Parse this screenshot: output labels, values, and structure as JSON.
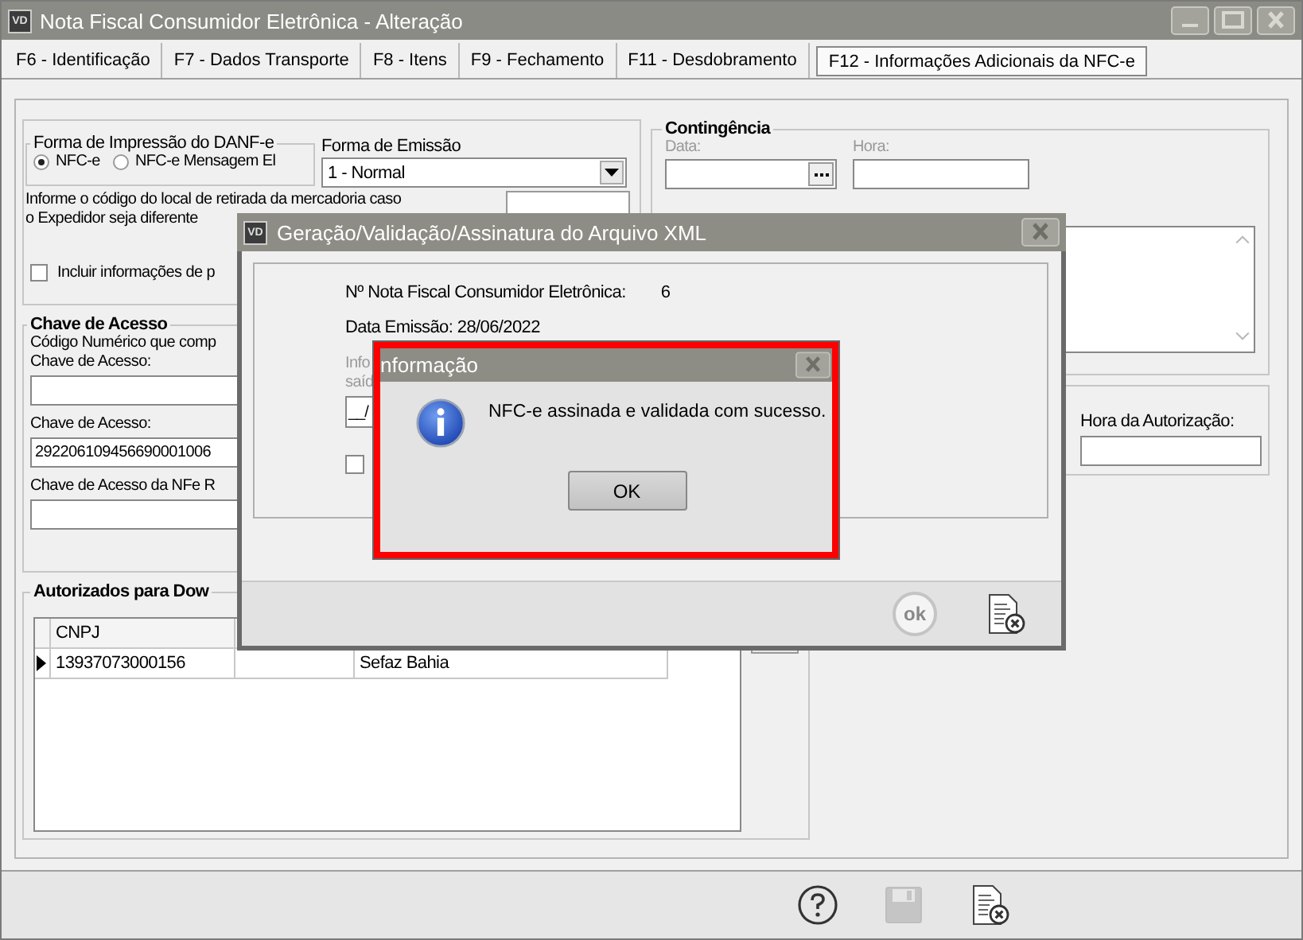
{
  "window": {
    "icon": "VD",
    "title": "Nota Fiscal Consumidor Eletrônica - Alteração"
  },
  "tabs": [
    {
      "label": "F6 - Identificação",
      "selected": false
    },
    {
      "label": "F7 - Dados Transporte",
      "selected": false
    },
    {
      "label": "F8 - Itens",
      "selected": false
    },
    {
      "label": "F9 - Fechamento",
      "selected": false
    },
    {
      "label": "F11 - Desdobramento",
      "selected": false
    },
    {
      "label": "F12 - Informações Adicionais da NFC-e",
      "selected": true
    }
  ],
  "danfe": {
    "title": "Forma de Impressão do DANF-e",
    "options": [
      {
        "label": "NFC-e",
        "selected": true
      },
      {
        "label": "NFC-e Mensagem El",
        "selected": false
      }
    ]
  },
  "emissao": {
    "label": "Forma de Emissão",
    "value": "1 - Normal"
  },
  "retirada": {
    "lines": [
      "Informe o código do local de retirada da mercadoria caso",
      "o Expedidor seja diferente"
    ]
  },
  "incluir": {
    "label": "Incluir informações de p",
    "checked": false
  },
  "chave": {
    "title": "Chave de Acesso",
    "fields": [
      {
        "label_lines": [
          "Código Numérico que comp",
          "Chave de Acesso:"
        ]
      },
      {
        "label_lines": [
          "Chave de Acesso:"
        ],
        "value": "292206109456690001006"
      },
      {
        "label_lines": [
          "Chave de Acesso da NFe R"
        ]
      }
    ]
  },
  "autorizados": {
    "title": "Autorizados para Dow",
    "columns": [
      "CNPJ"
    ],
    "rows": [
      {
        "selected": true,
        "cnpj": "13937073000156",
        "column_3": "Sefaz Bahia"
      }
    ]
  },
  "contingencia": {
    "title": "Contingência",
    "disabled": true,
    "fields": [
      {
        "label": "Data:",
        "kind": "date"
      },
      {
        "label": "Hora:",
        "kind": "text"
      }
    ]
  },
  "autorizacao": {
    "label": "Hora da Autorização:"
  },
  "toolbar": [
    {
      "kind": "help",
      "disabled": false
    },
    {
      "kind": "save",
      "disabled": true
    },
    {
      "kind": "cancel",
      "disabled": false
    }
  ],
  "xml_dialog": {
    "icon": "VD",
    "title": "Geração/Validação/Assinatura do Arquivo XML",
    "numero_label": "Nº Nota Fiscal Consumidor Eletrônica:",
    "numero": "6",
    "data_emissao": "Data Emissão: 28/06/2022",
    "hint_lines": [
      "Info",
      "saíd"
    ],
    "date_value": "__/",
    "checked": false,
    "buttons": [
      {
        "kind": "ok",
        "label": "ok",
        "disabled": true
      },
      {
        "kind": "cancel",
        "disabled": false
      }
    ]
  },
  "message_dialog": {
    "title": "nformação",
    "message": "NFC-e assinada e validada com sucesso.",
    "button": "OK"
  }
}
